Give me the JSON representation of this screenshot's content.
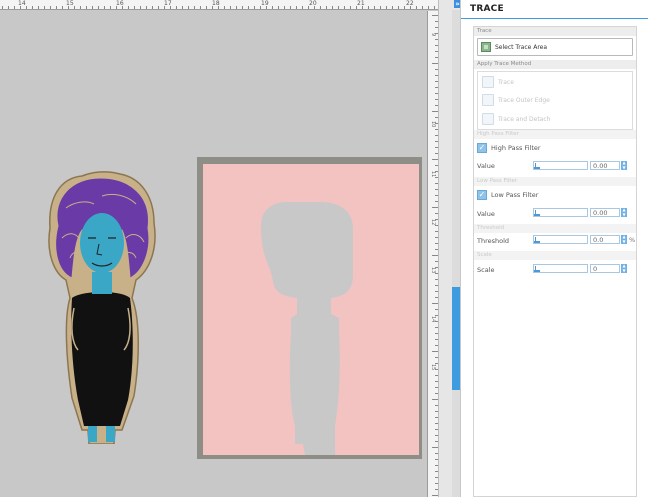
{
  "ruler": {
    "labels": [
      "14",
      "15",
      "16",
      "17",
      "18",
      "19",
      "20",
      "21",
      "22"
    ],
    "vertical_labels": [
      "9",
      "8",
      "10",
      "11",
      "12",
      "13",
      "14",
      "15"
    ]
  },
  "scrollbar": {
    "collapse_glyph": "»"
  },
  "panel": {
    "title": "TRACE",
    "trace_section": "Trace",
    "select_trace_area": "Select Trace Area",
    "apply_trace_method": "Apply Trace Method",
    "methods": [
      "Trace",
      "Trace Outer Edge",
      "Trace and Detach"
    ],
    "high_pass_header": "High Pass Filter",
    "high_pass_label": "High Pass Filter",
    "high_pass_value_label": "Value",
    "high_pass_value": "0.00",
    "low_pass_header": "Low Pass Filter",
    "low_pass_label": "Low Pass Filter",
    "low_pass_value_label": "Value",
    "low_pass_value": "0.00",
    "threshold_header": "Threshold",
    "threshold_label": "Threshold",
    "threshold_value": "0.0",
    "threshold_unit": "%",
    "scale_header": "Scale",
    "scale_label": "Scale",
    "scale_value": "0",
    "check_glyph": "✓",
    "spin_up": "▲",
    "spin_down": "▼"
  },
  "colors": {
    "accent": "#3d9be0",
    "board_pink": "#f3c3c1",
    "canvas_gray": "#c8c8c8"
  }
}
